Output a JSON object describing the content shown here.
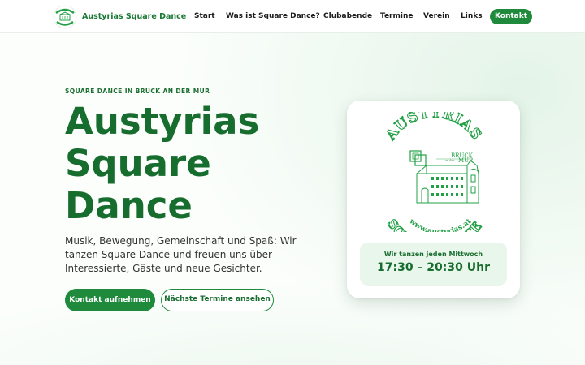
{
  "header": {
    "brand_name": "Austyrias Square Dance",
    "logo_icon": "club-logo-icon",
    "nav": [
      {
        "label": "Start"
      },
      {
        "label": "Was ist Square Dance?"
      },
      {
        "label": "Clubabende"
      },
      {
        "label": "Termine"
      },
      {
        "label": "Verein"
      },
      {
        "label": "Links"
      }
    ],
    "contact_label": "Kontakt"
  },
  "hero": {
    "eyebrow": "SQUARE DANCE IN BRUCK AN DER MUR",
    "title_lines": [
      "Austyrias",
      "Square",
      "Dance"
    ],
    "text": "Musik, Bewegung, Gemeinschaft und Spaß: Wir tanzen Square Dance und freuen uns über Interessierte, Gäste und neue Gesichter.",
    "primary_button": "Kontakt aufnehmen",
    "secondary_button": "Nächste Termine ansehen"
  },
  "card": {
    "logo": {
      "top_text": "AUSTYRIAS",
      "place_line1": "BRUCK",
      "place_small": "an der",
      "place_line2": "MUR",
      "url_text": "www.austyrias.at",
      "bottom_text": "SQUAREDANCE"
    },
    "schedule_label": "Wir tanzen jeden Mittwoch",
    "schedule_time": "17:30 – 20:30 Uhr"
  },
  "colors": {
    "brand_green": "#1f8a3c",
    "title_green": "#176d2e",
    "logo_green": "#22a045",
    "panel_green": "#e9f6ec"
  }
}
